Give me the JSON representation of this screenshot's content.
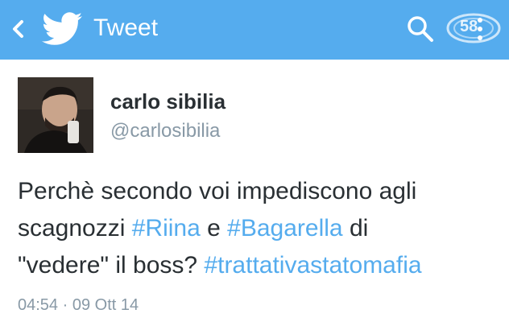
{
  "header": {
    "title": "Tweet",
    "bar_color": "#55acee",
    "icons": [
      "back-chevron-icon",
      "twitter-bird-icon",
      "search-icon",
      "overflow-menu-icon"
    ],
    "watermark_text": "58"
  },
  "tweet": {
    "author_name": "carlo sibilia",
    "author_handle": "@carlosibilia",
    "line1": "Perchè secondo voi impediscono agli",
    "line2_pre": "scagnozzi ",
    "hashtag1": "#Riina",
    "line2_mid": " e ",
    "hashtag2": "#Bagarella",
    "line2_post": " di",
    "line3_pre": "\"vedere\" il boss? ",
    "hashtag3": "#trattativastatomafia",
    "time": "04:54",
    "separator": " · ",
    "date": "09 Ott 14",
    "hashtag_color": "#55acee"
  }
}
